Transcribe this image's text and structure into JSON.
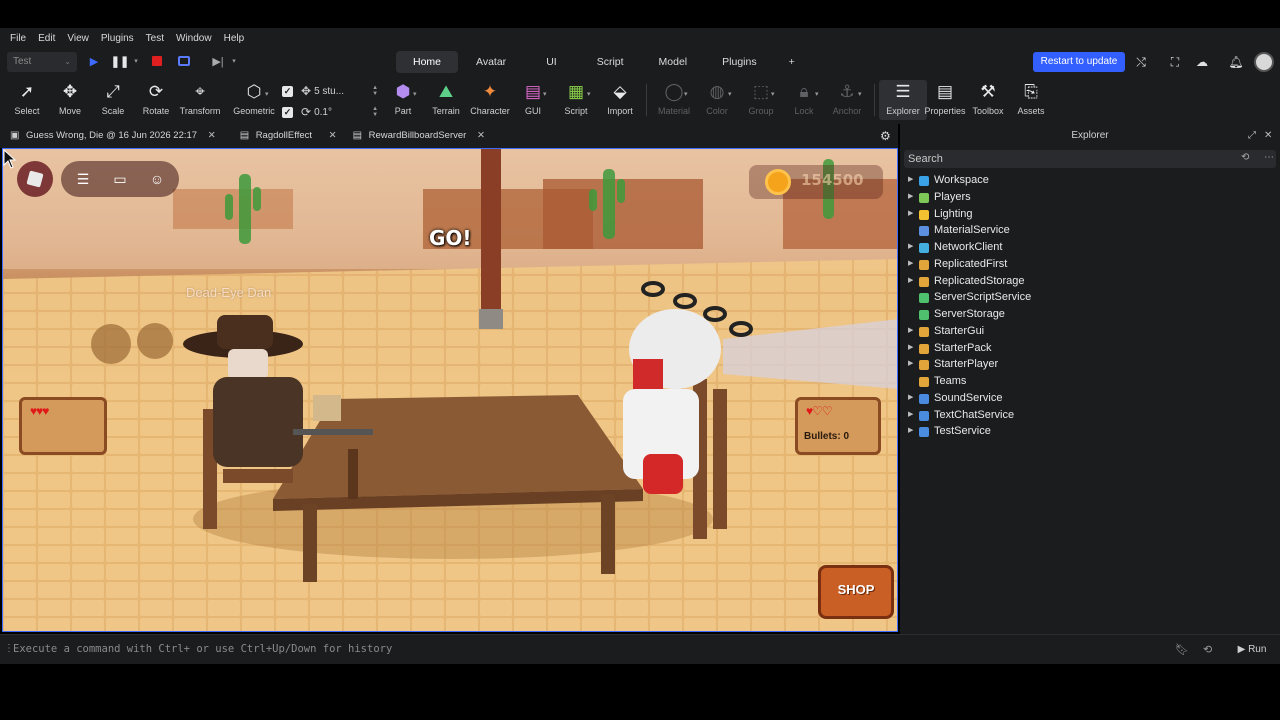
{
  "menu": [
    "File",
    "Edit",
    "View",
    "Plugins",
    "Test",
    "Window",
    "Help"
  ],
  "mode_select": {
    "value": "Test"
  },
  "ribbon_tabs": [
    "Home",
    "Avatar",
    "UI",
    "Script",
    "Model",
    "Plugins",
    "+"
  ],
  "restart_button": "Restart to update",
  "toolbar": {
    "select": "Select",
    "move": "Move",
    "scale": "Scale",
    "rotate": "Rotate",
    "transform": "Transform",
    "geometric": "Geometric",
    "move_snap": "5 stu...",
    "rotate_snap": "0.1°",
    "part": "Part",
    "terrain": "Terrain",
    "character": "Character",
    "gui": "GUI",
    "script": "Script",
    "import": "Import",
    "material": "Material",
    "color": "Color",
    "group": "Group",
    "lock": "Lock",
    "anchor": "Anchor",
    "explorer": "Explorer",
    "properties": "Properties",
    "toolbox": "Toolbox",
    "assets": "Assets"
  },
  "doc_tabs": [
    {
      "label": "Guess Wrong, Die @ 16 Jun 2026 22:17",
      "close": "✕"
    },
    {
      "label": "RagdollEffect",
      "close": "✕"
    },
    {
      "label": "RewardBillboardServer",
      "close": "✕"
    }
  ],
  "game": {
    "coins": "154500",
    "go_text": "GO!",
    "player_name": "Dead-Eye Dan",
    "left_hearts": "♥♥♥",
    "right_hearts": "♥♡♡",
    "bullets": "Bullets: 0",
    "shop": "SHOP"
  },
  "command_bar": {
    "placeholder": "Execute a command with Ctrl+ or use Ctrl+Up/Down for history",
    "run": "Run"
  },
  "explorer": {
    "title": "Explorer",
    "search_placeholder": "Search",
    "items": [
      {
        "name": "Workspace",
        "expandable": true,
        "color": "#3aa3e8"
      },
      {
        "name": "Players",
        "expandable": true,
        "color": "#7ec857"
      },
      {
        "name": "Lighting",
        "expandable": true,
        "color": "#f2c230"
      },
      {
        "name": "MaterialService",
        "expandable": false,
        "color": "#5d8fe0"
      },
      {
        "name": "NetworkClient",
        "expandable": true,
        "color": "#43b0e0"
      },
      {
        "name": "ReplicatedFirst",
        "expandable": true,
        "color": "#e2a53a"
      },
      {
        "name": "ReplicatedStorage",
        "expandable": true,
        "color": "#e2a53a"
      },
      {
        "name": "ServerScriptService",
        "expandable": false,
        "color": "#4fc06e"
      },
      {
        "name": "ServerStorage",
        "expandable": false,
        "color": "#4fc06e"
      },
      {
        "name": "StarterGui",
        "expandable": true,
        "color": "#e2a53a"
      },
      {
        "name": "StarterPack",
        "expandable": true,
        "color": "#e2a53a"
      },
      {
        "name": "StarterPlayer",
        "expandable": true,
        "color": "#e2a53a"
      },
      {
        "name": "Teams",
        "expandable": false,
        "color": "#e2a53a"
      },
      {
        "name": "SoundService",
        "expandable": true,
        "color": "#4a8be0"
      },
      {
        "name": "TextChatService",
        "expandable": true,
        "color": "#4a8be0"
      },
      {
        "name": "TestService",
        "expandable": true,
        "color": "#4a8be0"
      }
    ]
  },
  "colors": {
    "accent": "#335fff",
    "panel": "#1b1c1e",
    "viewport_border": "#3d6bff"
  }
}
